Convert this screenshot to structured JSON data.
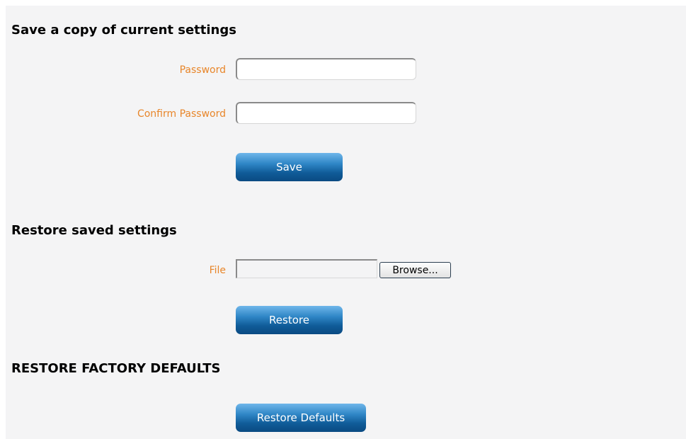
{
  "save_section": {
    "title": "Save a copy of current settings",
    "password_label": "Password",
    "password_value": "",
    "confirm_password_label": "Confirm Password",
    "confirm_password_value": "",
    "save_label": "Save"
  },
  "restore_section": {
    "title": "Restore saved settings",
    "file_label": "File",
    "browse_label": "Browse...",
    "restore_label": "Restore"
  },
  "factory_section": {
    "title": "RESTORE FACTORY DEFAULTS",
    "restore_defaults_label": "Restore Defaults"
  },
  "colors": {
    "label_orange": "#e8862a",
    "button_blue": "#1a6aa8",
    "panel_background": "#f4f4f5"
  }
}
